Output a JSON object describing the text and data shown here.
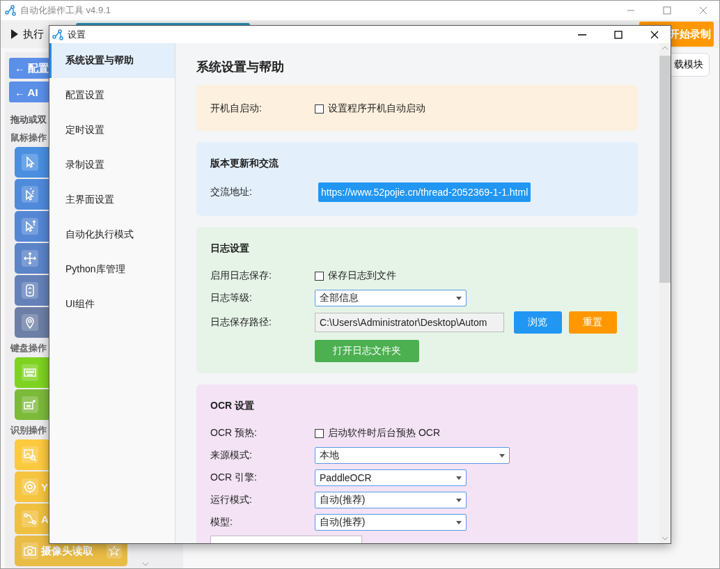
{
  "main_window": {
    "title": "自动化操作工具 v4.9.1",
    "toolbar": {
      "run_label": "执行",
      "record_button": "开始录制"
    },
    "load_button": "载模块",
    "palette": {
      "nav_buttons": [
        "← 配置",
        "← AI"
      ],
      "hint": "拖动或双",
      "groups": [
        {
          "title": "鼠标操作",
          "items": [
            {
              "kind": "cursor",
              "color": "#4a8fe0"
            },
            {
              "kind": "click",
              "color": "#4f8adb"
            },
            {
              "kind": "double",
              "color": "#5587d4"
            },
            {
              "kind": "move",
              "color": "#5b84c9"
            },
            {
              "kind": "scroll",
              "color": "#6581b9"
            },
            {
              "kind": "pin",
              "color": "#6d7fa6"
            }
          ]
        },
        {
          "title": "键盘操作",
          "items": [
            {
              "kind": "keyboard",
              "color": "#7ed321"
            },
            {
              "kind": "special",
              "color": "#7cba3a"
            }
          ]
        },
        {
          "title": "识别操作",
          "items": [
            {
              "kind": "image",
              "color": "#fcc93f"
            },
            {
              "label": "Y",
              "kind": "target",
              "color": "#f6c43f"
            },
            {
              "label": "A",
              "kind": "path",
              "color": "#f0c040"
            },
            {
              "label": "摄像头读取",
              "kind": "camera",
              "color": "#e9bc45",
              "favorite": false
            }
          ]
        }
      ]
    }
  },
  "dialog": {
    "title": "设置",
    "sidebar": [
      {
        "label": "系统设置与帮助",
        "selected": true
      },
      {
        "label": "配置设置",
        "selected": false
      },
      {
        "label": "定时设置",
        "selected": false
      },
      {
        "label": "录制设置",
        "selected": false
      },
      {
        "label": "主界面设置",
        "selected": false
      },
      {
        "label": "自动化执行模式",
        "selected": false
      },
      {
        "label": "Python库管理",
        "selected": false
      },
      {
        "label": "UI组件",
        "selected": false
      }
    ],
    "heading": "系统设置与帮助",
    "sections": [
      {
        "color": "#fdf0de",
        "rows": [
          {
            "kind": "checkbox",
            "label": "开机自启动:",
            "text": "设置程序开机自动启动",
            "checked": false
          }
        ]
      },
      {
        "color": "#e3f0fb",
        "title": "版本更新和交流",
        "rows": [
          {
            "kind": "link",
            "label": "交流地址:",
            "value": "https://www.52pojie.cn/thread-2052369-1-1.html"
          }
        ]
      },
      {
        "color": "#e6f4e8",
        "title": "日志设置",
        "rows": [
          {
            "kind": "checkbox",
            "label": "启用日志保存:",
            "text": "保存日志到文件",
            "checked": false
          },
          {
            "kind": "select",
            "label": "日志等级:",
            "value": "全部信息"
          },
          {
            "kind": "path",
            "label": "日志保存路径:",
            "value": "C:\\Users\\Administrator\\Desktop\\Autom",
            "buttons": [
              {
                "label": "浏览",
                "color": "#2196f3"
              },
              {
                "label": "重置",
                "color": "#ff9800"
              }
            ]
          },
          {
            "kind": "button",
            "text": "打开日志文件夹",
            "color": "#4caf50"
          }
        ]
      },
      {
        "color": "#f3e3f5",
        "title": "OCR 设置",
        "rows": [
          {
            "kind": "checkbox",
            "label": "OCR 预热:",
            "text": "启动软件时后台预热 OCR",
            "checked": false
          },
          {
            "kind": "select",
            "label": "来源模式:",
            "value": "本地"
          },
          {
            "kind": "select",
            "label": "OCR 引擎:",
            "value": "PaddleOCR"
          },
          {
            "kind": "select",
            "label": "运行模式:",
            "value": "自动(推荐)"
          },
          {
            "kind": "select",
            "label": "模型:",
            "value": "自动(推荐)"
          },
          {
            "kind": "input"
          }
        ]
      }
    ]
  }
}
